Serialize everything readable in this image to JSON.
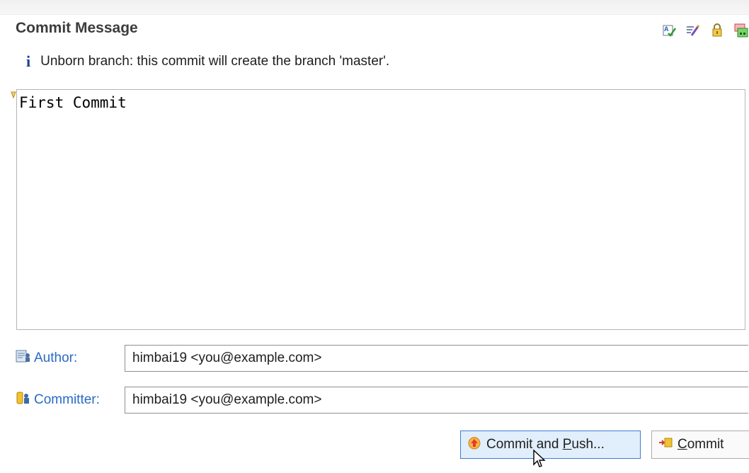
{
  "panel": {
    "title": "Commit Message",
    "toolbar_icons": [
      "spell-check-icon",
      "format-message-icon",
      "lock-icon",
      "signoff-icon"
    ]
  },
  "info": {
    "icon": "info-icon",
    "text": "Unborn branch: this commit will create the branch 'master'."
  },
  "message": {
    "value": "First Commit"
  },
  "author": {
    "label": "Author:",
    "value": "himbai19 <you@example.com>"
  },
  "committer": {
    "label": "Committer:",
    "value": "himbai19 <you@example.com>"
  },
  "buttons": {
    "commit_and_push": {
      "pre": "Commit and ",
      "mnemonic": "P",
      "post": "ush..."
    },
    "commit": {
      "mnemonic": "C",
      "post": "ommit"
    }
  },
  "colors": {
    "link_label": "#2a6ac4",
    "primary_button_bg": "#e1eefb",
    "primary_button_border": "#3d7dd5"
  }
}
